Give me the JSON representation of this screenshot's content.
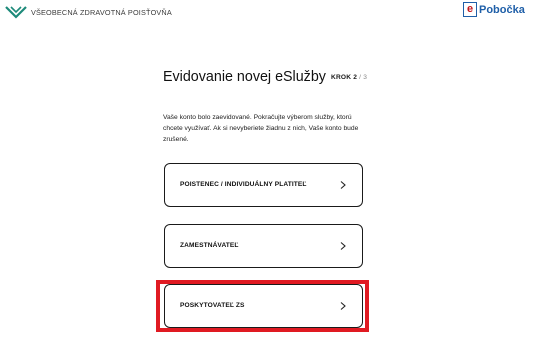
{
  "header": {
    "logo_text": "VŠEOBECNÁ ZDRAVOTNÁ POISŤOVŇA",
    "epobocka_letter": "e",
    "epobocka_text": "Pobočka"
  },
  "page": {
    "title": "Evidovanie novej eSlužby",
    "step_label": "KROK 2",
    "step_sep": "/",
    "step_total": "3",
    "description": "Vaše konto bolo zaevidované. Pokračujte výberom služby, ktorú chcete využívať. Ak si nevyberiete žiadnu z nich, Vaše konto bude zrušené."
  },
  "options": [
    {
      "label": "POISTENEC / INDIVIDUÁLNY PLATITEĽ",
      "icon": "chevron-right-icon"
    },
    {
      "label": "ZAMESTNÁVATEĽ",
      "icon": "chevron-right-icon"
    },
    {
      "label": "POSKYTOVATEĽ ZS",
      "icon": "chevron-right-icon",
      "highlighted": true
    }
  ],
  "colors": {
    "brand_blue": "#1f5fa8",
    "brand_red": "#c3161c",
    "logo_green": "#1d8a7a",
    "highlight": "#e01a22"
  }
}
